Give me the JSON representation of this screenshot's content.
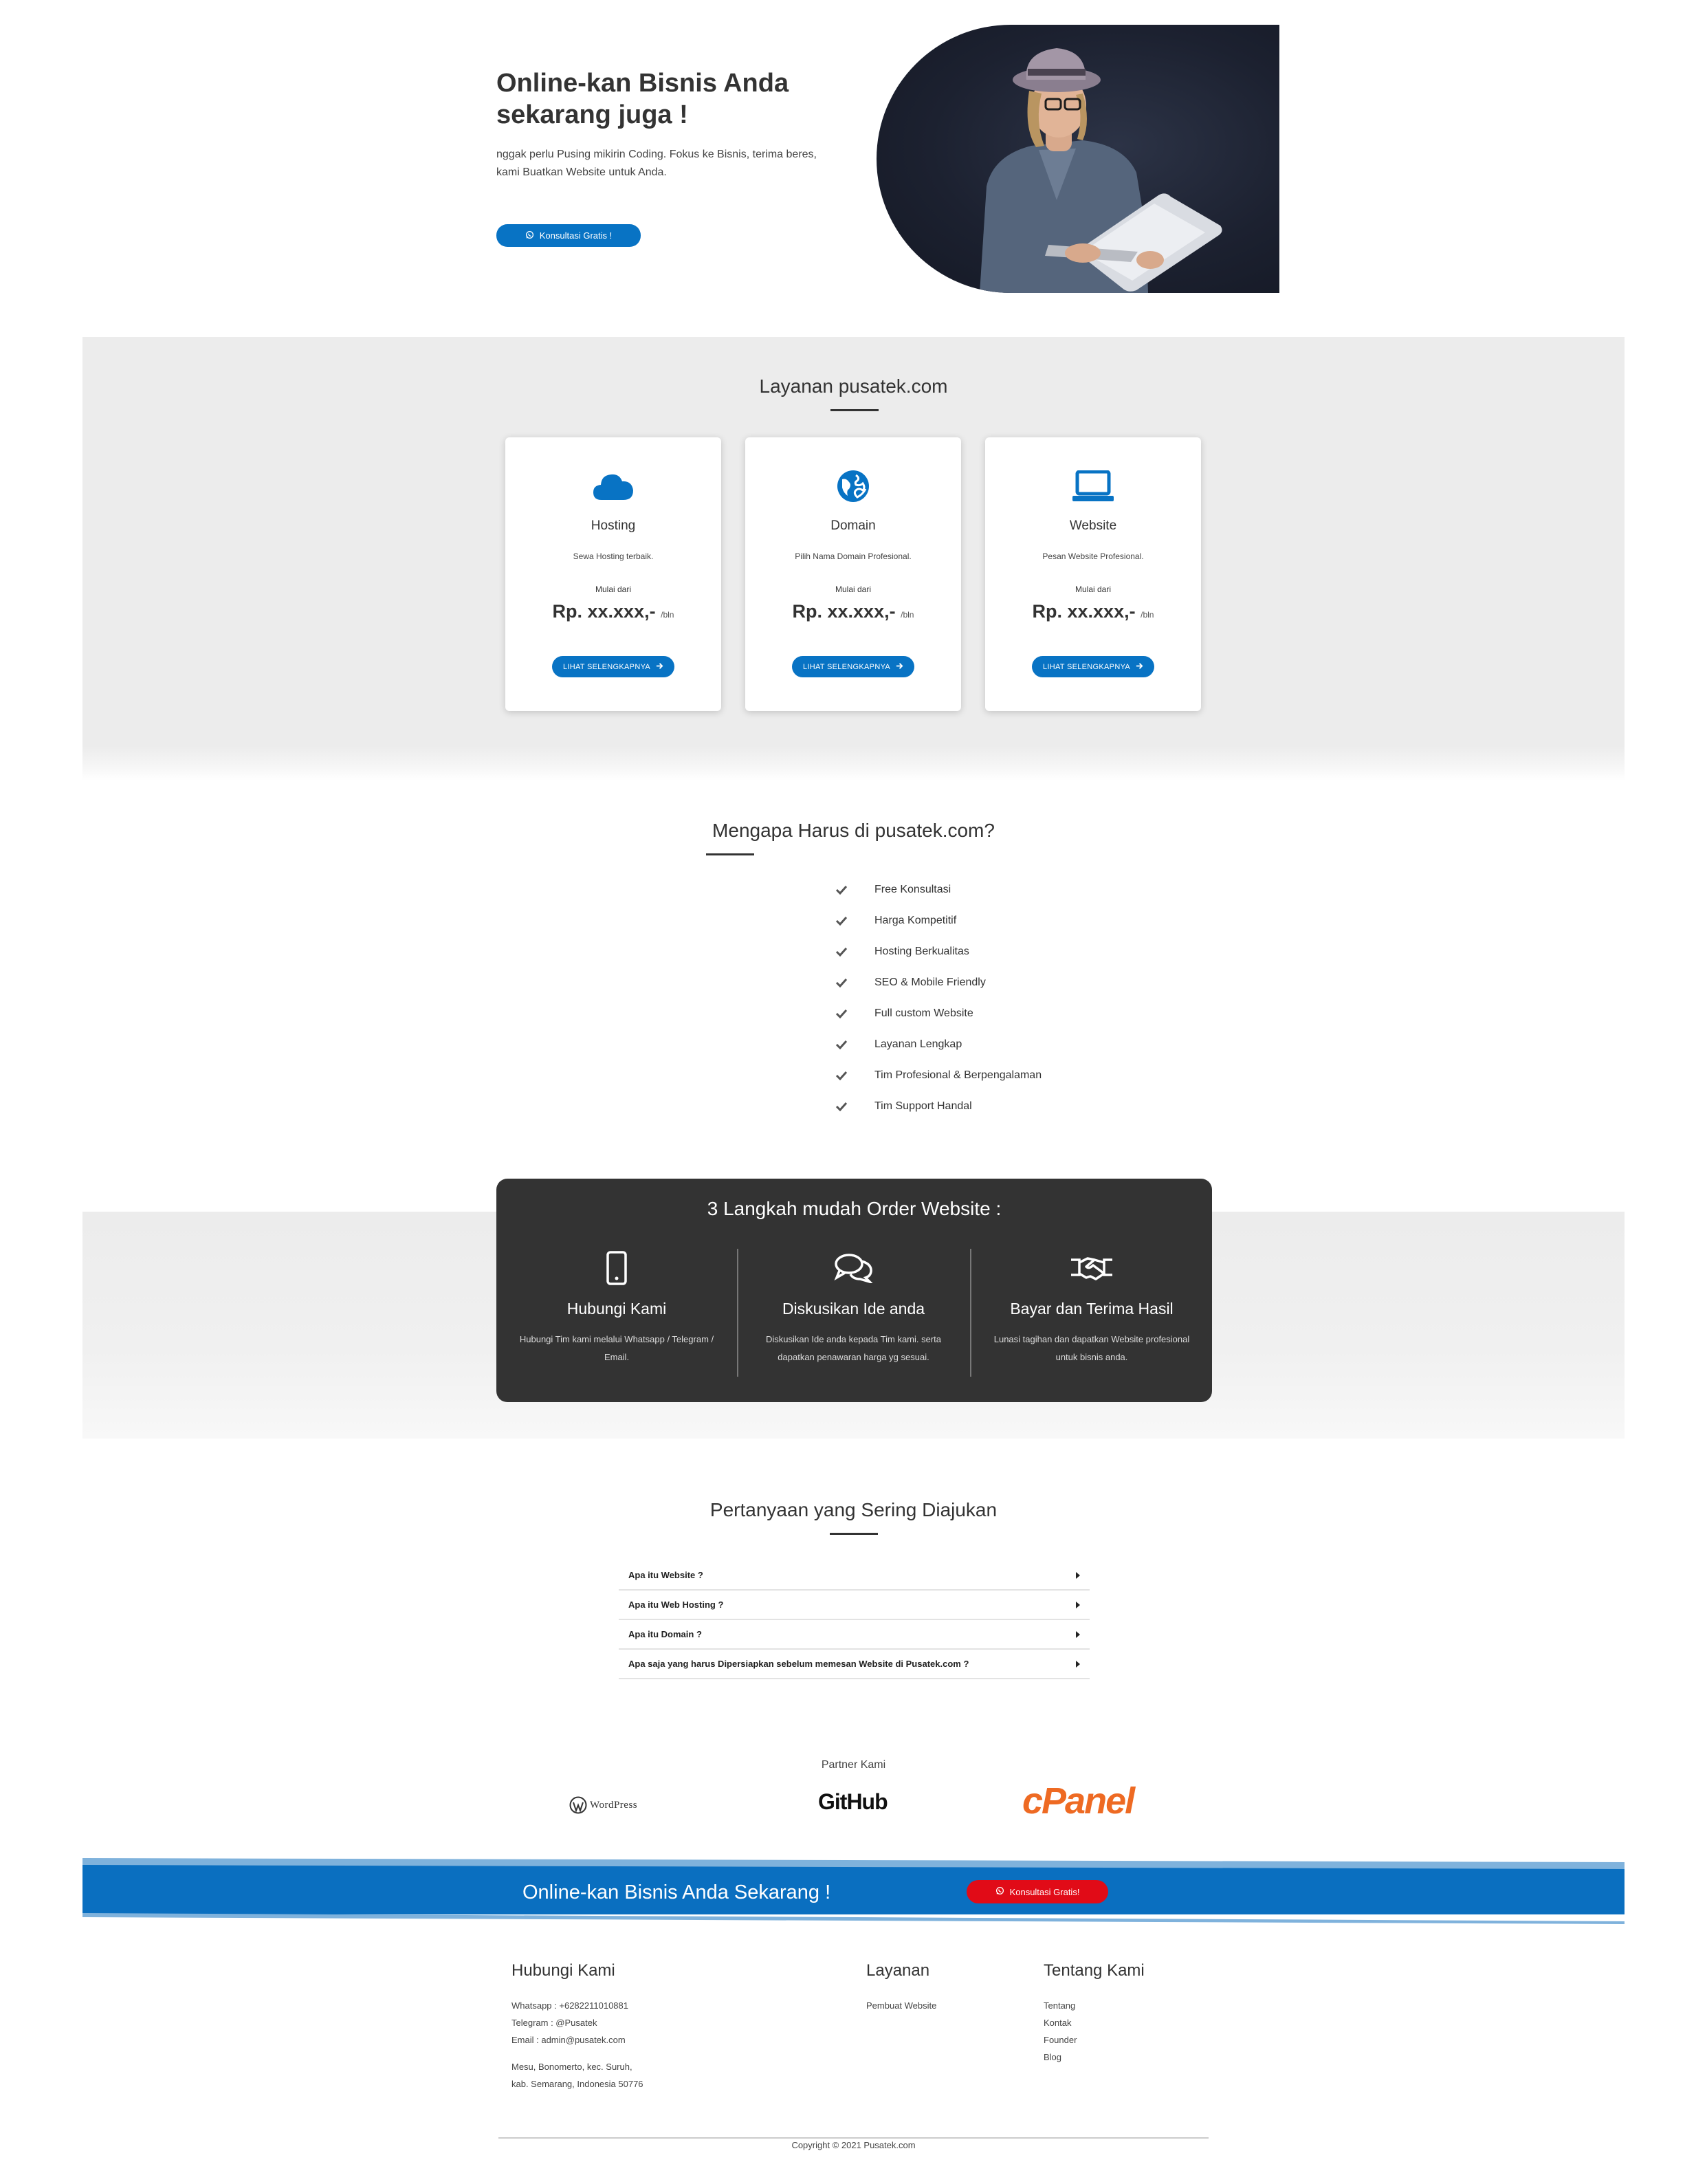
{
  "hero": {
    "title_line1": "Online-kan Bisnis Anda",
    "title_line2": "sekarang juga !",
    "subtitle_line1": "nggak perlu Pusing mikirin Coding. Fokus ke Bisnis, terima beres,",
    "subtitle_line2": "kami Buatkan Website untuk Anda.",
    "button_label": "Konsultasi Gratis !",
    "button_icon": "whatsapp-icon"
  },
  "services": {
    "title": "Layanan pusatek.com",
    "cards": [
      {
        "icon": "cloud-icon",
        "name": "Hosting",
        "desc": "Sewa Hosting terbaik.",
        "from": "Mulai dari",
        "price": "Rp. xx.xxx,-",
        "period": "/bln",
        "button": "LIHAT SELENGKAPNYA"
      },
      {
        "icon": "globe-icon",
        "name": "Domain",
        "desc": "Pilih Nama Domain Profesional.",
        "from": "Mulai dari",
        "price": "Rp. xx.xxx,-",
        "period": "/bln",
        "button": "LIHAT SELENGKAPNYA"
      },
      {
        "icon": "laptop-icon",
        "name": "Website",
        "desc": "Pesan Website Profesional.",
        "from": "Mulai dari",
        "price": "Rp. xx.xxx,-",
        "period": "/bln",
        "button": "LIHAT SELENGKAPNYA"
      }
    ]
  },
  "why": {
    "title": "Mengapa Harus di pusatek.com?",
    "items": [
      "Free Konsultasi",
      "Harga Kompetitif",
      "Hosting Berkualitas",
      "SEO & Mobile Friendly",
      "Full custom Website",
      "Layanan Lengkap",
      "Tim Profesional & Berpengalaman",
      "Tim Support Handal"
    ]
  },
  "steps": {
    "title": "3 Langkah mudah Order Website :",
    "items": [
      {
        "icon": "smartphone-icon",
        "name": "Hubungi Kami",
        "desc_line1": "Hubungi Tim kami melalui Whatsapp / Telegram /",
        "desc_line2": "Email."
      },
      {
        "icon": "comments-icon",
        "name": "Diskusikan Ide anda",
        "desc_line1": "Diskusikan Ide anda kepada Tim kami. serta",
        "desc_line2": "dapatkan penawaran harga yg sesuai."
      },
      {
        "icon": "handshake-icon",
        "name": "Bayar dan Terima Hasil",
        "desc_line1": "Lunasi tagihan dan dapatkan Website profesional",
        "desc_line2": "untuk bisnis anda."
      }
    ]
  },
  "faq": {
    "title": "Pertanyaan yang Sering Diajukan",
    "items": [
      "Apa itu Website ?",
      "Apa itu Web Hosting ?",
      "Apa itu Domain ?",
      "Apa saja yang harus Dipersiapkan sebelum memesan Website di Pusatek.com ?"
    ]
  },
  "partners": {
    "label": "Partner Kami",
    "logos": [
      "WordPress",
      "GitHub",
      "cPanel"
    ]
  },
  "cta": {
    "text": "Online-kan Bisnis Anda Sekarang !",
    "button": "Konsultasi Gratis!"
  },
  "footer": {
    "contact": {
      "title": "Hubungi Kami",
      "whatsapp": "Whatsapp : +6282211010881",
      "telegram": "Telegram : @Pusatek",
      "email": "Email : admin@pusatek.com",
      "address_line1": "Mesu, Bonomerto, kec. Suruh,",
      "address_line2": "kab. Semarang, Indonesia 50776"
    },
    "services": {
      "title": "Layanan",
      "links": [
        "Pembuat Website"
      ]
    },
    "about": {
      "title": "Tentang Kami",
      "links": [
        "Tentang",
        "Kontak",
        "Founder",
        "Blog"
      ]
    },
    "copyright": "Copyright © 2021 Pusatek.com"
  },
  "colors": {
    "accent_blue": "#0873c4",
    "cta_red": "#e10b17",
    "dark_box": "#333333",
    "cpanel_orange": "#ee6a23"
  }
}
